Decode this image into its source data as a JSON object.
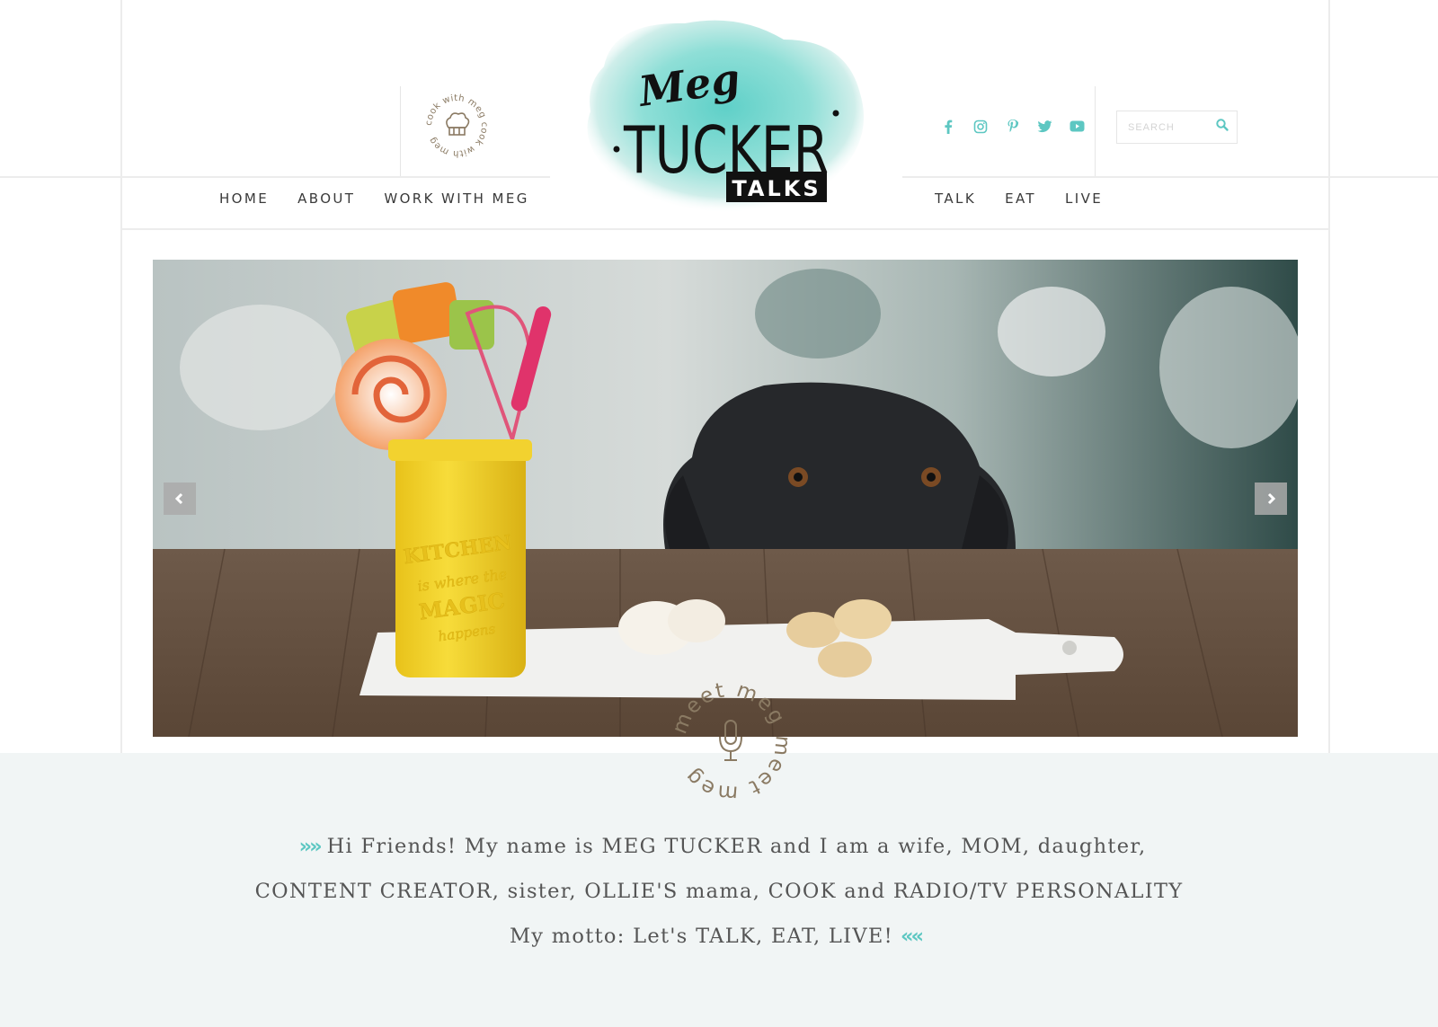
{
  "header": {
    "badge_text": "cook with meg cook with meg",
    "logo": {
      "line1": "Meg",
      "line2": "TUCKER",
      "line3": "TALKS"
    },
    "search_placeholder": "SEARCH",
    "social_icons": [
      "facebook-icon",
      "instagram-icon",
      "pinterest-icon",
      "twitter-icon",
      "youtube-icon"
    ],
    "accent_color": "#5dc7c2"
  },
  "nav": {
    "left": [
      "HOME",
      "ABOUT",
      "WORK WITH MEG"
    ],
    "right": [
      "TALK",
      "EAT",
      "LIVE"
    ]
  },
  "hero": {
    "jar_text": [
      "KITCHEN",
      "is where the",
      "MAGIC",
      "happens"
    ]
  },
  "intro": {
    "badge_text": "meet meg meet meg",
    "line1": "Hi Friends! My name is MEG TUCKER and I am a wife, MOM, daughter,",
    "line2": "CONTENT CREATOR, sister, OLLIE'S mama, COOK and RADIO/TV PERSONALITY",
    "line3": "My motto: Let's TALK, EAT, LIVE!",
    "open_chevrons": "»»",
    "close_chevrons": "««"
  }
}
